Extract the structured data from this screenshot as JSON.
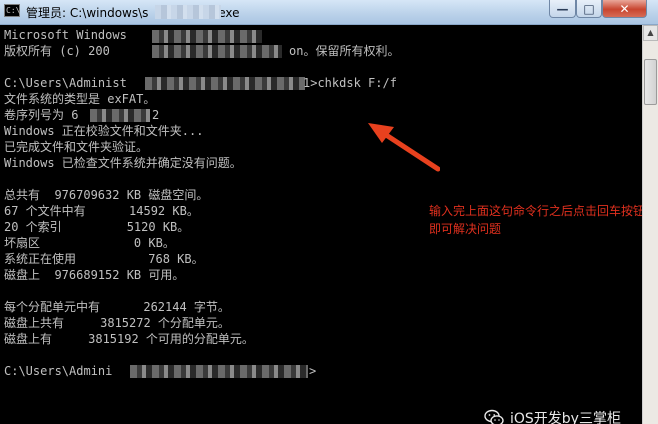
{
  "window": {
    "title_prefix": "管理员: C:\\windows\\s",
    "title_suffix": ".exe",
    "minimize_glyph": "—",
    "maximize_glyph": "□",
    "close_glyph": "✕"
  },
  "console": {
    "lines": [
      "Microsoft Windows",
      "版权所有 (c) 200",
      "",
      "文件系统的类型是 exFAT。",
      "卷序列号为 6",
      "Windows 正在校验文件和文件夹...",
      "已完成文件和文件夹验证。",
      "Windows 已检查文件系统并确定没有问题。",
      "",
      "总共有  976709632 KB 磁盘空间。",
      "67 个文件中有      14592 KB。",
      "20 个索引         5120 KB。",
      "坏扇区             0 KB。",
      "系统正在使用          768 KB。",
      "磁盘上  976689152 KB 可用。",
      "",
      "每个分配单元中有      262144 字节。",
      "磁盘上共有     3815272 个分配单元。",
      "磁盘上有     3815192 个可用的分配单元。"
    ],
    "line_2_tail": "on。保留所有权利。",
    "prompt_1_head": "C:\\Users\\Administ",
    "prompt_1_tail": "1>chkdsk F:/f",
    "line_5_tail": "2",
    "prompt_2_head": "C:\\Users\\Admini",
    "prompt_2_tail": ">"
  },
  "annotation": {
    "text": "输入完上面这句命令行之后点击回车按钮，即可解决问题",
    "color": "#e0301e"
  },
  "watermark": {
    "text": "iOS开发by三掌柜",
    "icon": "wechat-icon"
  }
}
